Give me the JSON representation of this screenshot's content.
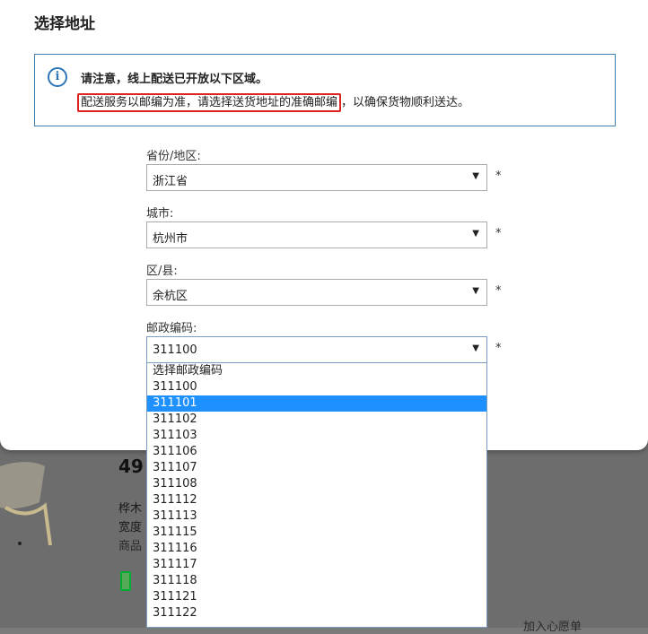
{
  "modal": {
    "title": "选择地址",
    "notice": {
      "title": "请注意，线上配送已开放以下区域。",
      "highlighted": "配送服务以邮编为准，请选择送货地址的准确邮编",
      "rest": "，以确保货物顺利送达。"
    },
    "fields": {
      "province": {
        "label": "省份/地区:",
        "value": "浙江省"
      },
      "city": {
        "label": "城市:",
        "value": "杭州市"
      },
      "district": {
        "label": "区/县:",
        "value": "余杭区"
      },
      "postcode": {
        "label": "邮政编码:",
        "value": "311100"
      }
    },
    "required_mark": "*",
    "postcode_options": [
      "选择邮政编码",
      "311100",
      "311101",
      "311102",
      "311103",
      "311106",
      "311107",
      "311108",
      "311112",
      "311113",
      "311115",
      "311116",
      "311117",
      "311118",
      "311121",
      "311122"
    ],
    "postcode_highlighted": "311101"
  },
  "background": {
    "price": "49",
    "line1": "桦木",
    "line2": "宽度",
    "line3": "商品",
    "wishlist": "加入心愿单"
  },
  "colors": {
    "highlight_border": "#dd2222",
    "option_selected": "#1e90ff",
    "notice_border": "#3f7fb0"
  }
}
